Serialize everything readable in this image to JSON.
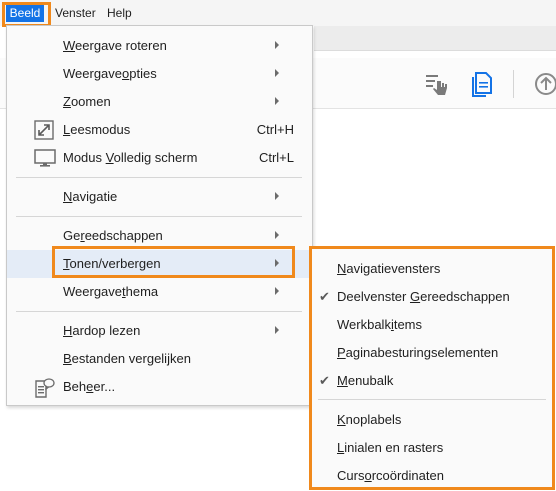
{
  "menubar": {
    "items": [
      {
        "label": "Beeld"
      },
      {
        "label": "Venster"
      },
      {
        "label": "Help"
      }
    ]
  },
  "icons": {
    "read_mode": "expand-arrows-icon",
    "fullscreen": "monitor-icon",
    "manage": "document-comment-icon",
    "toolbar_touch": "hand-touch-icon",
    "toolbar_doc": "document-pages-icon",
    "toolbar_up": "arrow-up-circle-icon",
    "checkmark": "checkmark-icon"
  },
  "colors": {
    "highlight": "#f0891c",
    "menu_selected": "#1473e6",
    "hover_row": "#e4ecf7"
  },
  "menu": {
    "rotate": {
      "u": "W",
      "rest": "eergave roteren"
    },
    "options": {
      "pre": "Weergave",
      "u": "o",
      "rest": "pties"
    },
    "zoom": {
      "u": "Z",
      "rest": "oomen"
    },
    "read_mode": {
      "u": "L",
      "rest": "eesmodus",
      "shortcut": "Ctrl+H"
    },
    "fullscreen": {
      "pre": "Modus ",
      "u": "V",
      "rest": "olledig scherm",
      "shortcut": "Ctrl+L"
    },
    "navigation": {
      "u": "N",
      "rest": "avigatie"
    },
    "tools": {
      "pre": "Ge",
      "u": "r",
      "rest": "eedschappen"
    },
    "showhide": {
      "u": "T",
      "rest": "onen/verbergen"
    },
    "theme": {
      "pre": "Weergave",
      "u": "t",
      "rest": "hema"
    },
    "readaloud": {
      "u": "H",
      "rest": "ardop lezen"
    },
    "compare": {
      "u": "B",
      "rest": "estanden vergelijken"
    },
    "manage": {
      "pre": "Beh",
      "u": "e",
      "rest": "er..."
    }
  },
  "submenu": {
    "navpanes": {
      "u": "N",
      "rest": "avigatievensters",
      "checked": false
    },
    "toolspane": {
      "pre": "Deelvenster ",
      "u": "G",
      "rest": "ereedschappen",
      "checked": true
    },
    "toolbaritems": {
      "pre": "Werkbalk",
      "u": "i",
      "rest": "tems",
      "checked": false
    },
    "pagecontrols": {
      "u": "P",
      "rest": "aginabesturingselementen",
      "checked": false
    },
    "menubar": {
      "u": "M",
      "rest": "enubalk",
      "checked": true
    },
    "buttonlabels": {
      "u": "K",
      "rest": "noplabels",
      "checked": false
    },
    "rulers": {
      "u": "L",
      "rest": "inialen en rasters",
      "checked": false
    },
    "cursor": {
      "pre": "Curs",
      "u": "o",
      "rest": "rcoördinaten",
      "checked": false
    },
    "check_glyph": "✔"
  }
}
